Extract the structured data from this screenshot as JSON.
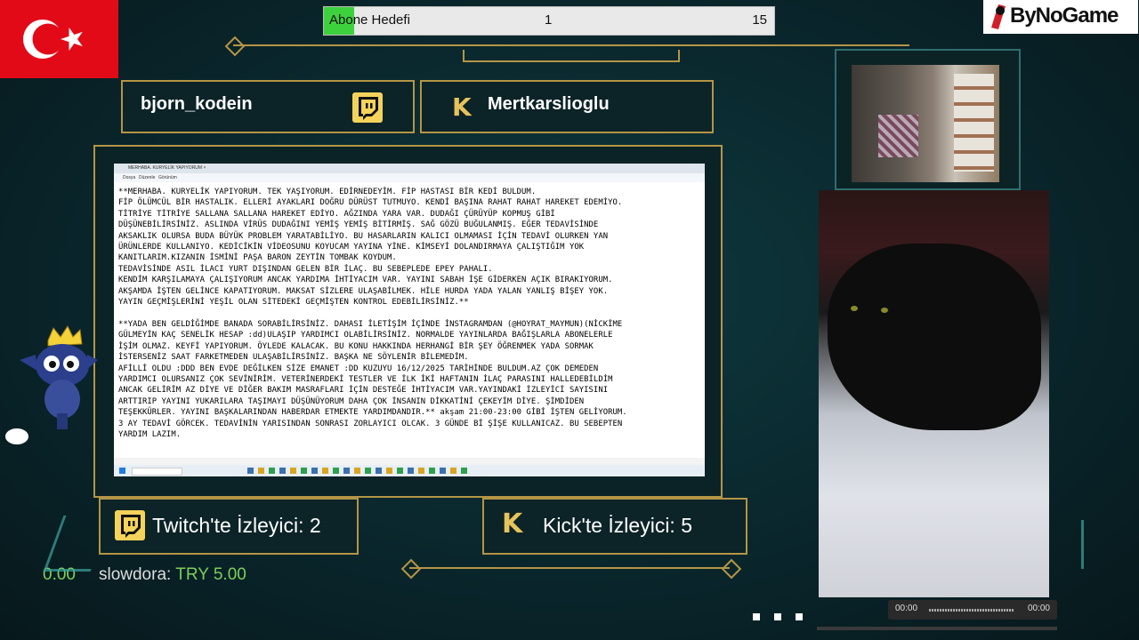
{
  "goal": {
    "label": "Abone Hedefi",
    "current": "1",
    "target": "15",
    "progress": 0.0667
  },
  "logo": {
    "text": "ByNoGame"
  },
  "streamers": {
    "twitch_name": "bjorn_kodein",
    "kick_name": "Mertkarslioglu",
    "kick_letter": "K"
  },
  "viewers": {
    "twitch_label": "Twitch'te İzleyici: 2",
    "kick_label": "Kick'te İzleyici: 5"
  },
  "screen": {
    "tab_title": "MERHABA. KURYELİK YAPIYORUM ×",
    "menu": [
      "Dosya",
      "Düzenle",
      "Görünüm"
    ],
    "document_text": "**MERHABA. KURYELİK YAPIYORUM. TEK YAŞIYORUM. EDİRNEDEYİM. FİP HASTASI BİR KEDİ BULDUM.\nFİP ÖLÜMCÜL BİR HASTALIK. ELLERİ AYAKLARI DOĞRU DÜRÜST TUTMUYO. KENDİ BAŞINA RAHAT RAHAT HAREKET EDEMİYO.\nTİTRİYE TİTRİYE SALLANA SALLANA HAREKET EDİYO. AĞZINDA YARA VAR. DUDAĞI ÇÜRÜYÜP KOPMUŞ GİBİ\nDÜŞÜNEBİLİRSİNİZ. ASLINDA VİRÜS DUDAĞINI YEMİŞ YEMİŞ BİTİRMİŞ. SAĞ GÖZÜ BUĞULANMIŞ. EĞER TEDAVİSİNDE\nAKSAKLIK OLURSA BUDA BÜYÜK PROBLEM YARATABİLİYO. BU HASARLARIN KALICI OLMAMASI İÇİN TEDAVİ OLURKEN YAN\nÜRÜNLERDE KULLANIYO. KEDİCİKİN VİDEOSUNU KOYUCAM YAYINA YİNE. KİMSEYİ DOLANDIRMAYA ÇALIŞTIĞIM YOK\nKANITLARIM.KIZANIN İSMİNİ PAŞA BARON ZEYTİN TOMBAK KOYDUM.\nTEDAVİSİNDE ASIL İLACI YURT DIŞINDAN GELEN BİR İLAÇ. BU SEBEPLEDE EPEY PAHALI.\nKENDİM KARŞILAMAYA ÇALIŞIYORUM ANCAK YARDIMA İHTİYACIM VAR. YAYINI SABAH İŞE GİDERKEN AÇIK BIRAKIYORUM.\nAKŞAMDA İŞTEN GELİNCE KAPATIYORUM. MAKSAT SİZLERE ULAŞABİLMEK. HİLE HURDA YADA YALAN YANLIŞ BİŞEY YOK.\nYAYIN GEÇMİŞLERİNİ YEŞİL OLAN SİTEDEKİ GEÇMİŞTEN KONTROL EDEBİLİRSİNİZ.**\n\n**YADA BEN GELDİĞİMDE BANADA SORABİLİRSİNİZ. DAHASI İLETİŞİM İÇİNDE İNSTAGRAMDAN (@HOYRAT_MAYMUN)(NİCKİME\nGÜLMEYİN KAÇ SENELİK HESAP :dd)ULAŞIP YARDIMCI OLABİLİRSİNİZ. NORMALDE YAYINLARDA BAĞIŞLARLA ABONELERLE\nİŞİM OLMAZ. KEYFİ YAPIYORUM. ÖYLEDE KALACAK. BU KONU HAKKINDA HERHANGİ BİR ŞEY ÖĞRENMEK YADA SORMAK\nİSTERSENİZ SAAT FARKETMEDEN ULAŞABİLİRSİNİZ. BAŞKA NE SÖYLENİR BİLEMEDİM.\nAFİLLİ OLDU :DDD BEN EVDE DEĞİLKEN SİZE EMANET :DD KUZUYU 16/12/2025 TARİHİNDE BULDUM.AZ ÇOK DEMEDEN\nYARDIMCI OLURSANIZ ÇOK SEVİNİRİM. VETERİNERDEKİ TESTLER VE İLK İKİ HAFTANIN İLAÇ PARASINI HALLEDEBİLDİM\nANCAK GELİRİM AZ DİYE VE DİĞER BAKIM MASRAFLARI İÇİN DESTEĞE İHTİYACIM VAR.YAYINDAKİ İZLEYİCİ SAYISINI\nARTTIRIP YAYINI YUKARILARA TAŞIMAYI DÜŞÜNÜYORUM DAHA ÇOK İNSANIN DİKKATİNİ ÇEKEYİM DİYE. ŞİMDİDEN\nTEŞEKKÜRLER. YAYINI BAŞKALARINDAN HABERDAR ETMEKTE YARDIMDANDIR.** akşam 21:00-23:00 GİBİ İŞTEN GELİYORUM.\n3 AY TEDAVİ GÖRCEK. TEDAVİNİN YARISINDAN SONRASI ZORLAYICI OLCAK. 3 GÜNDE Bİ ŞİŞE KULLANICAZ. BU SEBEPTEN\nYARDIM LAZIM."
  },
  "video": {
    "time_current": "00:00",
    "time_total": "00:00"
  },
  "ticker": {
    "amount_prev": "0.00",
    "user": "slowdora:",
    "amount": "TRY 5.00"
  },
  "colors": {
    "gold": "#b49546",
    "goal_fill": "#3ed13e",
    "donation": "#7ecf5a",
    "flag_red": "#e30a17"
  }
}
